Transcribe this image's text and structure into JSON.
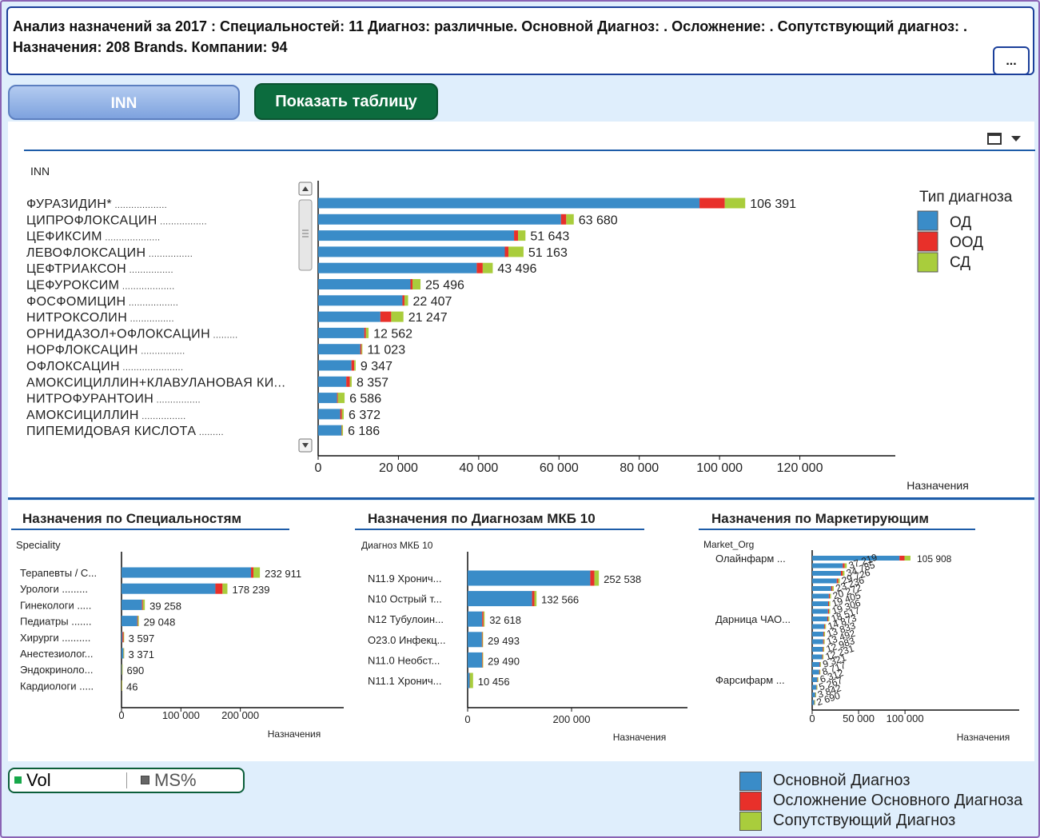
{
  "header": {
    "title": "Анализ назначений за 2017 : Специальностей: 11 Диагноз: различные. Основной Диагноз: . Осложнение: . Сопутствующий диагноз: . Назначения: 208 Brands. Компании: 94",
    "more_label": "..."
  },
  "buttons": {
    "inn_label": "INN",
    "show_table_label": "Показать таблицу"
  },
  "colors": {
    "od": "#3a8cc8",
    "ood": "#e8302a",
    "sd": "#a9cd3c"
  },
  "main_chart_legend": {
    "title": "Тип диагноза",
    "items": [
      {
        "label": "ОД",
        "color": "#3a8cc8"
      },
      {
        "label": "ООД",
        "color": "#e8302a"
      },
      {
        "label": "СД",
        "color": "#a9cd3c"
      }
    ]
  },
  "bottom_titles": {
    "speciality": "Назначения по Специальностям",
    "diagnosis": "Назначения по Диагнозам МКБ 10",
    "market": "Назначения по Маркетирующим"
  },
  "toggle": {
    "vol_label": "Vol",
    "ms_label": "MS%"
  },
  "bottom_legend": [
    {
      "label": "Основной Диагноз",
      "color": "#3a8cc8"
    },
    {
      "label": "Осложнение Основного Диагноза",
      "color": "#e8302a"
    },
    {
      "label": "Сопутствующий Диагноз",
      "color": "#a9cd3c"
    }
  ],
  "chart_data": [
    {
      "type": "bar",
      "orientation": "horizontal",
      "stacked": true,
      "title": "",
      "ylabel": "INN",
      "xlabel": "Назначения",
      "xlim": [
        0,
        140000
      ],
      "xticks": [
        0,
        20000,
        40000,
        60000,
        80000,
        100000,
        120000
      ],
      "xtick_labels": [
        "0",
        "20 000",
        "40 000",
        "60 000",
        "80 000",
        "100 000",
        "120 000"
      ],
      "categories": [
        "ФУРАЗИДИН*",
        "ЦИПРОФЛОКСАЦИН",
        "ЦЕФИКСИМ",
        "ЛЕВОФЛОКСАЦИН",
        "ЦЕФТРИАКСОН",
        "ЦЕФУРОКСИМ",
        "ФОСФОМИЦИН",
        "НИТРОКСОЛИН",
        "ОРНИДАЗОЛ+ОФЛОКСАЦИН",
        "НОРФЛОКСАЦИН",
        "ОФЛОКСАЦИН",
        "АМОКСИЦИЛЛИН+КЛАВУЛАНОВАЯ КИ...",
        "НИТРОФУРАНТОИН",
        "АМОКСИЦИЛЛИН",
        "ПИПЕМИДОВАЯ КИСЛОТА"
      ],
      "category_dots": [
        "...................",
        ".................",
        "....................",
        "................",
        "................",
        "...................",
        "..................",
        "................",
        ".........",
        "................",
        "......................",
        "",
        "................",
        "................",
        "........."
      ],
      "totals": [
        106391,
        63680,
        51643,
        51163,
        43496,
        25496,
        22407,
        21247,
        12562,
        11023,
        9347,
        8357,
        6586,
        6372,
        6186
      ],
      "total_labels": [
        "106 391",
        "63 680",
        "51 643",
        "51 163",
        "43 496",
        "25 496",
        "22 407",
        "21 247",
        "12 562",
        "11 023",
        "9 347",
        "8 357",
        "6 586",
        "6 372",
        "6 186"
      ],
      "series": [
        {
          "name": "ОД",
          "values": [
            95000,
            60500,
            48800,
            46500,
            39500,
            23000,
            21000,
            15500,
            11500,
            10500,
            8300,
            7000,
            4700,
            5500,
            5800
          ]
        },
        {
          "name": "ООД",
          "values": [
            6300,
            1300,
            1000,
            900,
            1500,
            500,
            500,
            2700,
            400,
            300,
            700,
            900,
            200,
            400,
            100
          ]
        },
        {
          "name": "СД",
          "values": [
            5091,
            1880,
            1843,
            3763,
            2496,
            1996,
            907,
            3047,
            662,
            223,
            347,
            457,
            1686,
            472,
            286
          ]
        }
      ],
      "legend_position": "right"
    },
    {
      "type": "bar",
      "orientation": "horizontal",
      "stacked": true,
      "ylabel": "Speciality",
      "xlabel": "Назначения",
      "xlim": [
        0,
        370000
      ],
      "xticks": [
        0,
        100000,
        200000
      ],
      "xtick_labels": [
        "0",
        "100 000",
        "200 000"
      ],
      "categories": [
        "Терапевты / С...",
        "Урологи .........",
        "Гинекологи .....",
        "Педиатры .......",
        "Хирурги ..........",
        "Анестезиолог...",
        "Эндокриноло...",
        "Кардиологи ....."
      ],
      "totals": [
        232911,
        178239,
        39258,
        29048,
        3597,
        3371,
        690,
        46
      ],
      "total_labels": [
        "232 911",
        "178 239",
        "39 258",
        "29 048",
        "3 597",
        "3 371",
        "690",
        "46"
      ],
      "series": [
        {
          "name": "ОД",
          "values": [
            218000,
            158000,
            34500,
            26500,
            1500,
            3200,
            600,
            40
          ]
        },
        {
          "name": "ООД",
          "values": [
            4000,
            12000,
            1500,
            1000,
            1900,
            100,
            50,
            3
          ]
        },
        {
          "name": "СД",
          "values": [
            10911,
            8239,
            3258,
            1548,
            197,
            71,
            40,
            3
          ]
        }
      ]
    },
    {
      "type": "bar",
      "orientation": "horizontal",
      "stacked": true,
      "ylabel": "Диагноз МКБ 10",
      "xlabel": "Назначения",
      "xlim": [
        0,
        400000
      ],
      "xticks": [
        0,
        200000
      ],
      "xtick_labels": [
        "0",
        "200 000"
      ],
      "categories": [
        "N11.9 Хронич...",
        "N10 Острый т...",
        "N12 Тубулоин...",
        "O23.0 Инфекц...",
        "N11.0 Необст...",
        "N11.1 Хронич..."
      ],
      "totals": [
        252538,
        132566,
        32618,
        29493,
        29490,
        10456
      ],
      "total_labels": [
        "252 538",
        "132 566",
        "32 618",
        "29 493",
        "29 490",
        "10 456"
      ],
      "series": [
        {
          "name": "ОД",
          "values": [
            236000,
            124000,
            28000,
            27500,
            27800,
            4000
          ]
        },
        {
          "name": "ООД",
          "values": [
            8000,
            4500,
            2500,
            1000,
            900,
            300
          ]
        },
        {
          "name": "СД",
          "values": [
            8538,
            4066,
            2118,
            993,
            790,
            6156
          ]
        }
      ]
    },
    {
      "type": "bar",
      "orientation": "horizontal",
      "stacked": true,
      "ylabel": "Market_Org",
      "xlabel": "Назначения",
      "xlim": [
        0,
        180000
      ],
      "xticks": [
        0,
        50000,
        100000
      ],
      "xtick_labels": [
        "0",
        "50 000",
        "100 000"
      ],
      "categories": [
        "Олайнфарм ...",
        "",
        "",
        "",
        "",
        "",
        "",
        "",
        "Дарница ЧАО...",
        "",
        "",
        "",
        "",
        "",
        "",
        "",
        "Фарсифарм ...",
        "",
        "",
        ""
      ],
      "totals": [
        105908,
        37219,
        34785,
        29726,
        23236,
        20272,
        19405,
        19306,
        18517,
        14873,
        13833,
        13492,
        12983,
        12231,
        9321,
        8717,
        6312,
        5267,
        3842,
        2690
      ],
      "total_labels": [
        "105 908",
        "37 219",
        "34 785",
        "29 726",
        "23 236",
        "20 272",
        "19 405",
        "19 306",
        "18 517",
        "14 873",
        "13 833",
        "13 492",
        "12 983",
        "12 231",
        "9 321",
        "8 717",
        "6 312",
        "5 267",
        "3 842",
        "2 690"
      ],
      "series": [
        {
          "name": "ОД",
          "values": [
            94000,
            33000,
            31000,
            26500,
            20500,
            18000,
            17200,
            17000,
            16300,
            13000,
            12000,
            11800,
            11400,
            10700,
            8100,
            7600,
            5500,
            4600,
            3300,
            2300
          ]
        },
        {
          "name": "ООД",
          "values": [
            5500,
            2000,
            1800,
            1600,
            1300,
            1100,
            1000,
            1100,
            1000,
            900,
            800,
            800,
            700,
            700,
            600,
            500,
            400,
            300,
            250,
            200
          ]
        },
        {
          "name": "СД",
          "values": [
            6408,
            2219,
            1985,
            1626,
            1436,
            1172,
            1205,
            1206,
            1217,
            973,
            1033,
            892,
            883,
            831,
            621,
            617,
            412,
            367,
            292,
            190
          ]
        }
      ]
    }
  ]
}
